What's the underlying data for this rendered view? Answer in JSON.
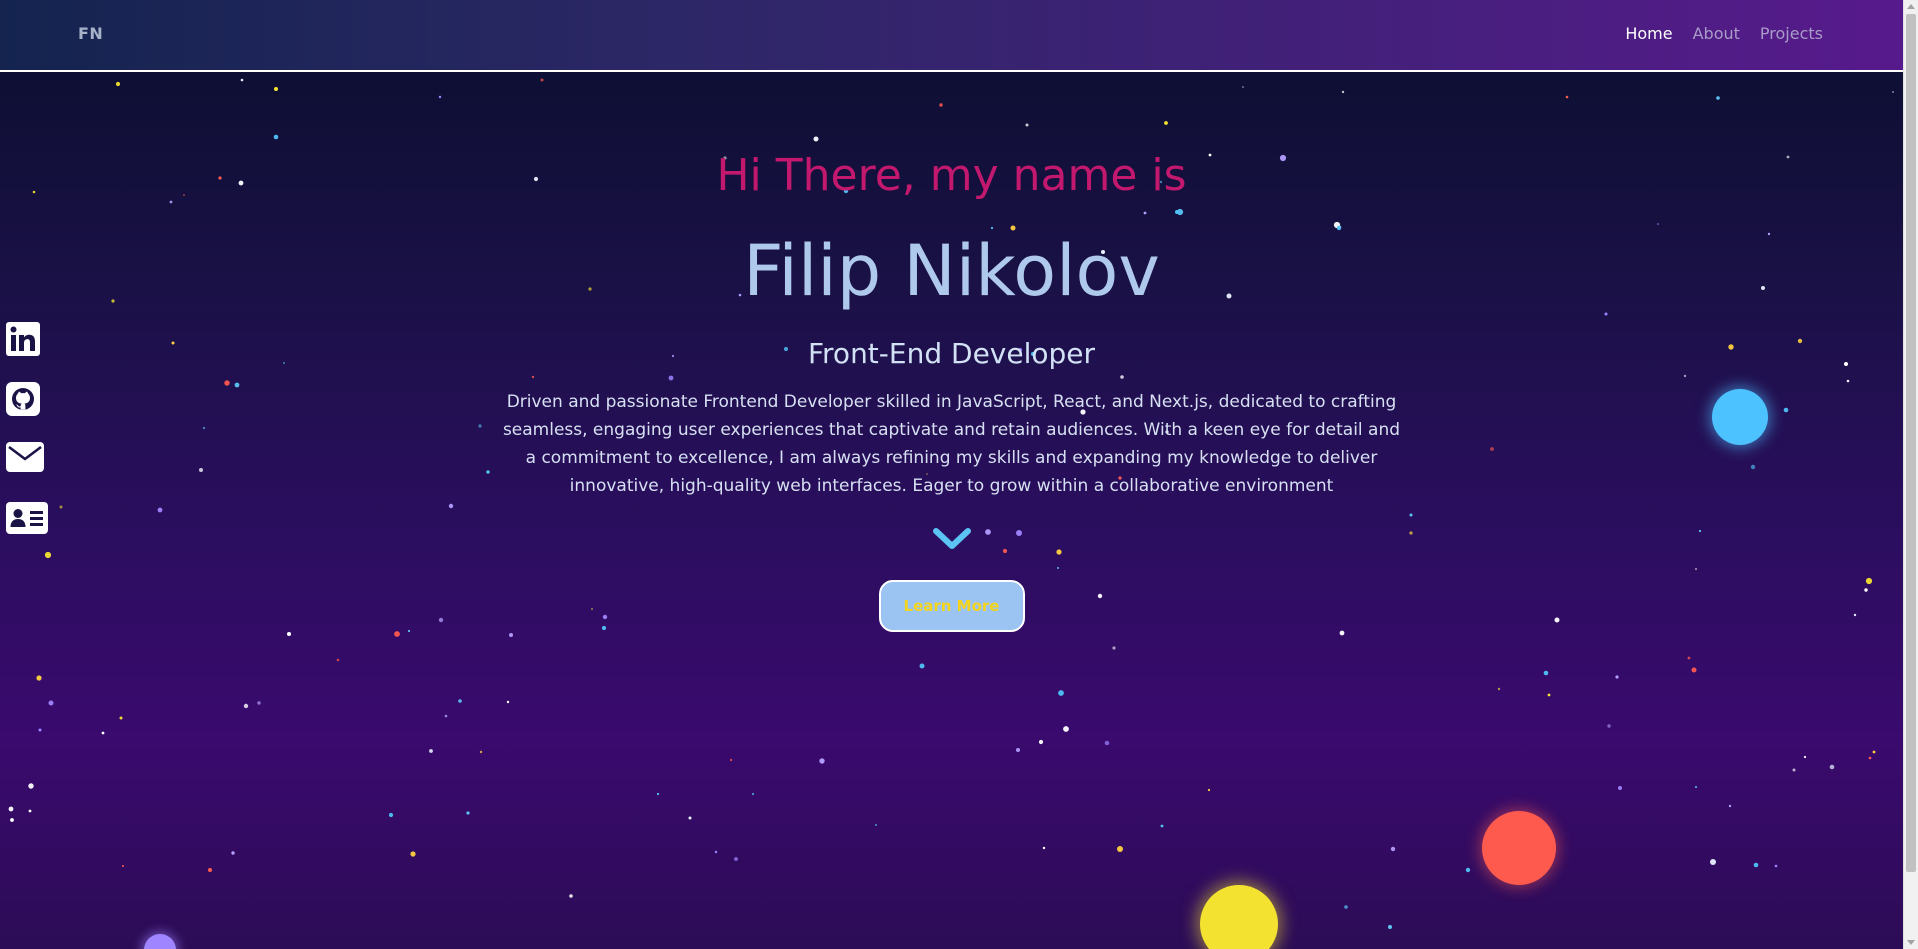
{
  "brand": "FN",
  "nav": {
    "items": [
      {
        "label": "Home",
        "active": true
      },
      {
        "label": "About",
        "active": false
      },
      {
        "label": "Projects",
        "active": false
      }
    ]
  },
  "social": {
    "items": [
      {
        "icon": "linkedin-icon"
      },
      {
        "icon": "github-icon"
      },
      {
        "icon": "mail-icon"
      },
      {
        "icon": "contact-card-icon"
      }
    ]
  },
  "hero": {
    "greeting": "Hi There, my name is",
    "name": "Filip Nikolov",
    "role": "Front-End Developer",
    "bio": "Driven and passionate Frontend Developer skilled in JavaScript, React, and Next.js, dedicated to crafting seamless, engaging user experiences that captivate and retain audiences. With a keen eye for detail and a commitment to excellence, I am always refining my skills and expanding my knowledge to deliver innovative, high-quality web interfaces. Eager to grow within a collaborative environment",
    "cta_label": "Learn More"
  },
  "colors": {
    "accent_pink": "#c2186e",
    "name_blue": "#aec9ec",
    "chevron_blue": "#5bc4f5",
    "button_bg": "#9cc4f2",
    "button_text": "#f4d41c",
    "planet_blue": "#4cc2ff",
    "planet_red": "#ff5a4e",
    "planet_yellow": "#f4e230",
    "planet_purple": "#9f85ff"
  }
}
